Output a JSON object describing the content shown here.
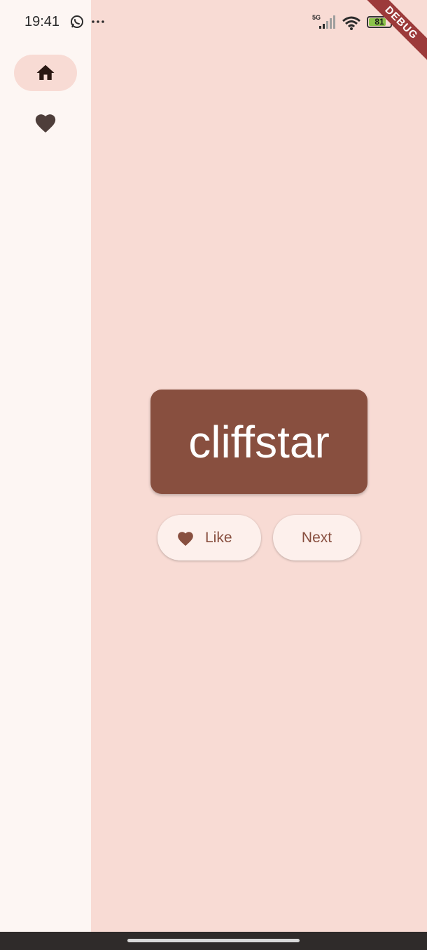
{
  "status_bar": {
    "time": "19:41",
    "network": "5G",
    "battery": "81",
    "battery_level": 0.81,
    "icons": [
      "whatsapp-icon",
      "more-icon",
      "signal-icon",
      "wifi-icon",
      "battery-icon"
    ]
  },
  "debug_banner": {
    "label": "DEBUG"
  },
  "nav_rail": {
    "items": [
      {
        "icon": "home-icon",
        "selected": true
      },
      {
        "icon": "favorite-icon",
        "selected": false
      }
    ]
  },
  "main": {
    "word": "cliffstar",
    "like_label": "Like",
    "next_label": "Next"
  },
  "colors": {
    "background": "#f8dbd4",
    "rail": "#fdf6f3",
    "card": "#884f3f",
    "button": "#fdf0ec",
    "accent_text": "#884f3f",
    "debug": "#9c3a3a"
  }
}
